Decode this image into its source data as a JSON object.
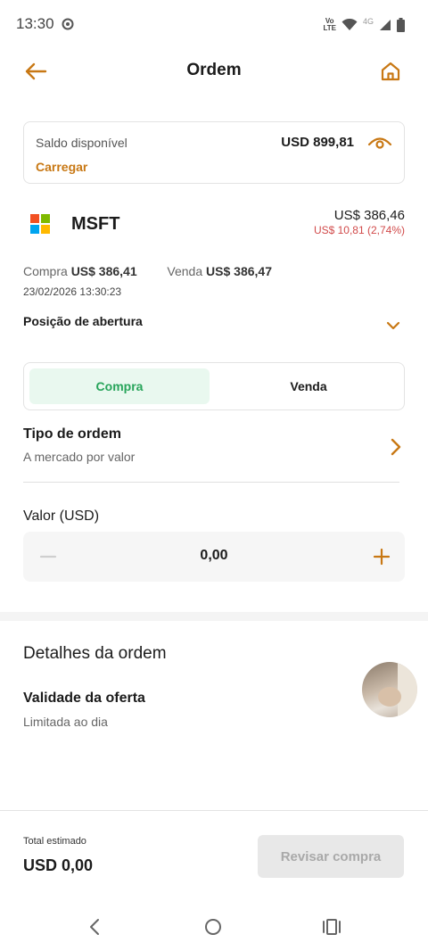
{
  "status_bar": {
    "time": "13:30",
    "volte_line1": "Vo",
    "volte_line2": "LTE",
    "network": "4G"
  },
  "header": {
    "title": "Ordem",
    "back_icon": "arrow-left-icon",
    "home_icon": "home-icon"
  },
  "balance": {
    "label": "Saldo disponível",
    "value": "USD 899,81",
    "action": "Carregar",
    "eye_icon": "eye-icon"
  },
  "ticker": {
    "symbol": "MSFT",
    "price": "US$ 386,46",
    "change": "US$ 10,81 (2,74%)",
    "logo_colors": [
      "#f25022",
      "#7fba00",
      "#00a4ef",
      "#ffb900"
    ]
  },
  "quote": {
    "buy_label": "Compra",
    "buy_value": "US$ 386,41",
    "sell_label": "Venda",
    "sell_value": "US$ 386,47",
    "datetime": "23/02/2026 13:30:23"
  },
  "position": {
    "label": "Posição de abertura"
  },
  "side_toggle": {
    "buy": "Compra",
    "sell": "Venda",
    "selected": "Compra"
  },
  "order_type": {
    "title": "Tipo de ordem",
    "value": "A mercado por valor"
  },
  "amount": {
    "label": "Valor (USD)",
    "value": "0,00"
  },
  "details": {
    "title": "Detalhes da ordem",
    "validity_title": "Validade da oferta",
    "validity_value": "Limitada ao dia"
  },
  "footer": {
    "total_label": "Total estimado",
    "total_value": "USD 0,00",
    "review_button": "Revisar compra"
  },
  "colors": {
    "accent": "#c87814",
    "buy_green": "#27a45a",
    "negative_red": "#d14a4a"
  }
}
